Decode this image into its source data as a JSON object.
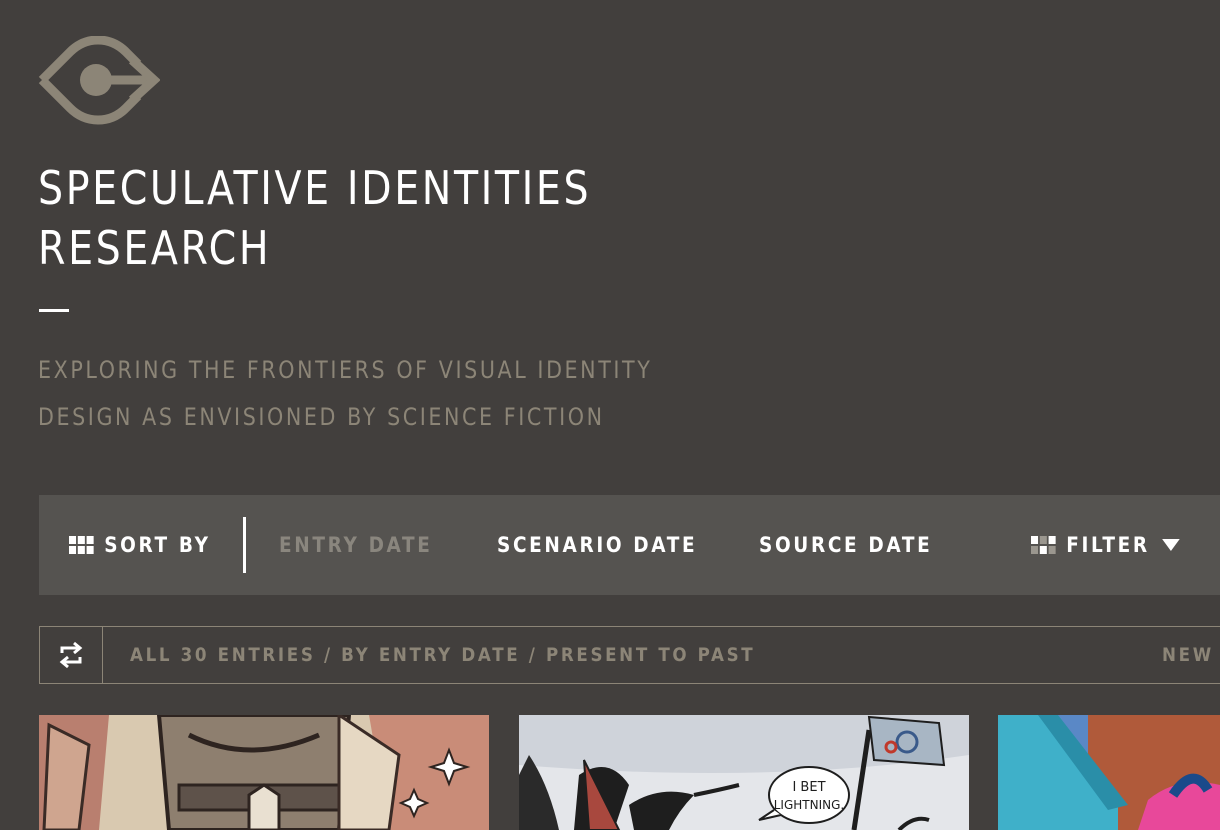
{
  "brand": {
    "logo_icon": "eye-arrow-logo-icon",
    "title_lines": [
      "SPECULATIVE IDENTITIES",
      "RESEARCH"
    ],
    "tagline_lines": [
      "EXPLORING THE FRONTIERS OF VISUAL IDENTITY",
      "DESIGN AS ENVISIONED BY SCIENCE FICTION"
    ]
  },
  "sortbar": {
    "sort_label": "SORT BY",
    "options": [
      "ENTRY DATE",
      "SCENARIO DATE",
      "SOURCE DATE"
    ],
    "active_option": "ENTRY DATE",
    "filter_label": "FILTER"
  },
  "status": {
    "summary": "ALL 30 ENTRIES / BY ENTRY DATE / PRESENT TO PAST",
    "right_text": "NEW"
  },
  "cards": [
    {
      "image": "comic-illustration-stars"
    },
    {
      "image": "comic-birds-flag",
      "speech": "I BET LIGHTNING."
    },
    {
      "image": "colorful-building"
    }
  ],
  "colors": {
    "background": "#423f3d",
    "bar": "#555350",
    "muted": "#8c8577",
    "text": "#ffffff"
  }
}
